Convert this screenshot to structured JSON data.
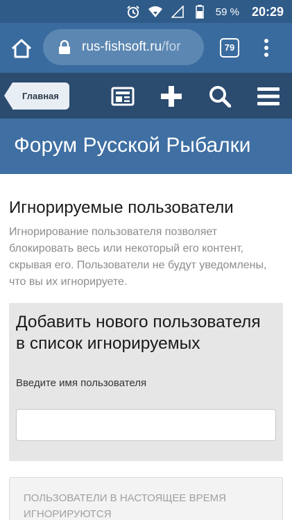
{
  "status_bar": {
    "battery": "59 %",
    "time": "20:29",
    "icons": [
      "alarm-icon",
      "wifi-icon",
      "signal-icon",
      "battery-icon"
    ]
  },
  "browser": {
    "url_host": "rus-fishsoft.ru",
    "url_path": "/for",
    "tab_count": "79",
    "icons": [
      "home-icon",
      "lock-icon",
      "more-vertical-icon"
    ]
  },
  "forum_nav": {
    "home_crumb": "Главная",
    "icons": [
      "news-feed-icon",
      "plus-icon",
      "search-icon",
      "hamburger-menu-icon"
    ]
  },
  "forum": {
    "title": "Форум Русской Рыбалки"
  },
  "page": {
    "title": "Игнорируемые пользователи",
    "description": "Игнорирование пользователя позволяет блокировать весь или некоторый его контент, скрывая его. Пользователи не будут уведомлены, что вы их игнорируете."
  },
  "add_panel": {
    "title": "Добавить нового пользователя в список игнорируемых",
    "label": "Введите имя пользователя",
    "input_value": ""
  },
  "ignored_panel": {
    "heading": "ПОЛЬЗОВАТЕЛИ В НАСТОЯЩЕЕ ВРЕМЯ ИГНОРИРУЮТСЯ"
  },
  "colors": {
    "status_bar": "#2f5b88",
    "browser_bar": "#3a6b9e",
    "forum_nav": "#2b4b6f",
    "title_band": "#3f6fa3",
    "panel_bg": "#e6e6e6"
  }
}
